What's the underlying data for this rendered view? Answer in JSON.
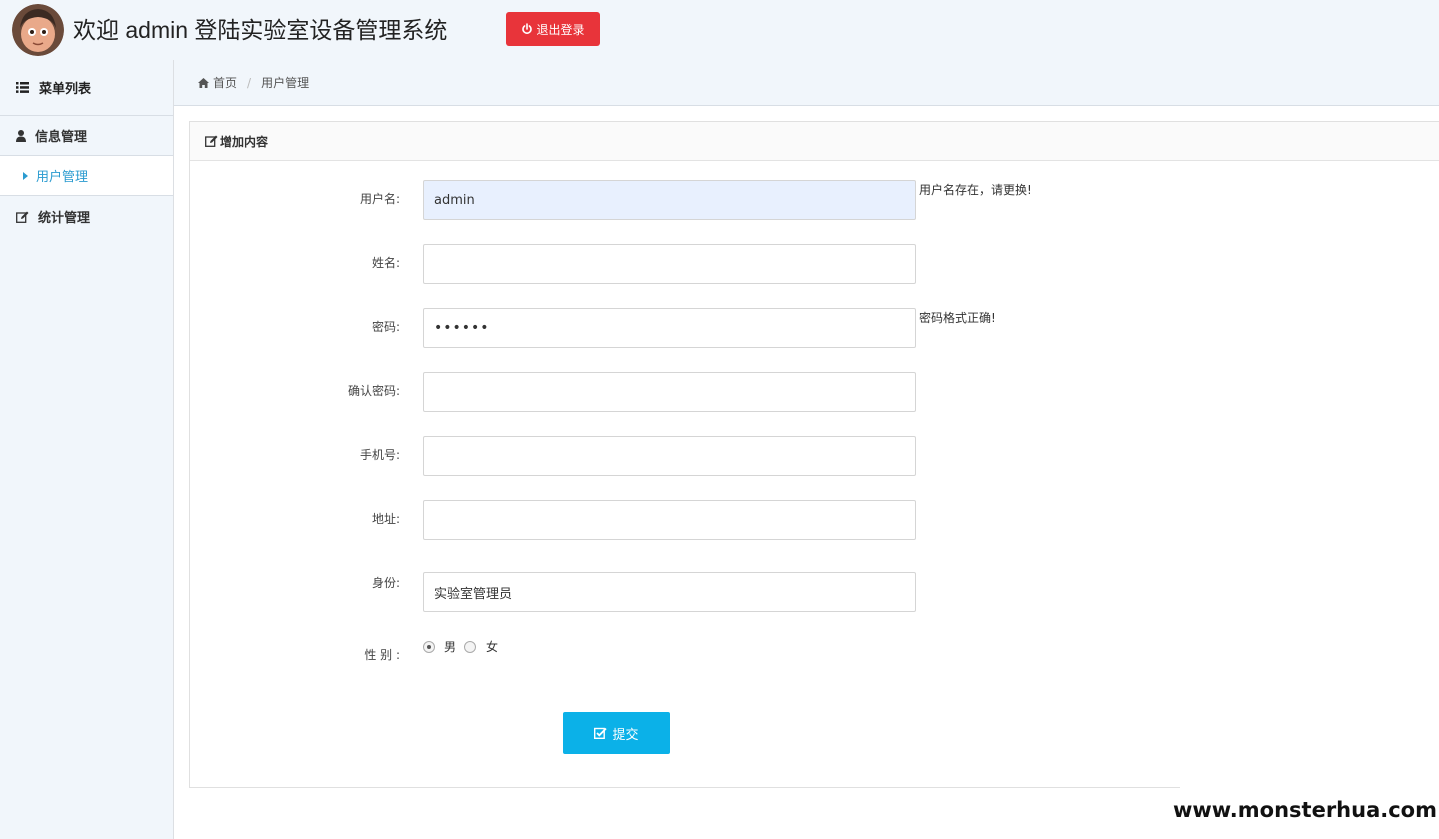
{
  "header": {
    "title": "欢迎 admin 登陆实验室设备管理系统",
    "logout_label": "退出登录",
    "logout_color": "#e8343a"
  },
  "sidebar": {
    "heading": "菜单列表",
    "groups": [
      {
        "label": "信息管理",
        "icon": "user-icon"
      },
      {
        "label": "统计管理",
        "icon": "edit-icon"
      }
    ],
    "sub_items": [
      {
        "label": "用户管理",
        "icon": "caret-right-icon",
        "active": true
      }
    ]
  },
  "breadcrumb": {
    "home": "首页",
    "current": "用户管理"
  },
  "panel": {
    "title": "增加内容"
  },
  "form": {
    "username": {
      "label": "用户名:",
      "value": "admin",
      "hint": "用户名存在，请更换!"
    },
    "name": {
      "label": "姓名:",
      "value": ""
    },
    "password": {
      "label": "密码:",
      "value": "••••••",
      "hint": "密码格式正确!"
    },
    "confirm_password": {
      "label": "确认密码:",
      "value": ""
    },
    "phone": {
      "label": "手机号:",
      "value": ""
    },
    "address": {
      "label": "地址:",
      "value": ""
    },
    "role": {
      "label": "身份:",
      "value": "实验室管理员"
    },
    "gender": {
      "label": "性 别 :",
      "options": [
        "男",
        "女"
      ],
      "selected": "男"
    },
    "submit_label": "提交",
    "submit_color": "#0bb1e8"
  },
  "watermark": "www.monsterhua.com"
}
